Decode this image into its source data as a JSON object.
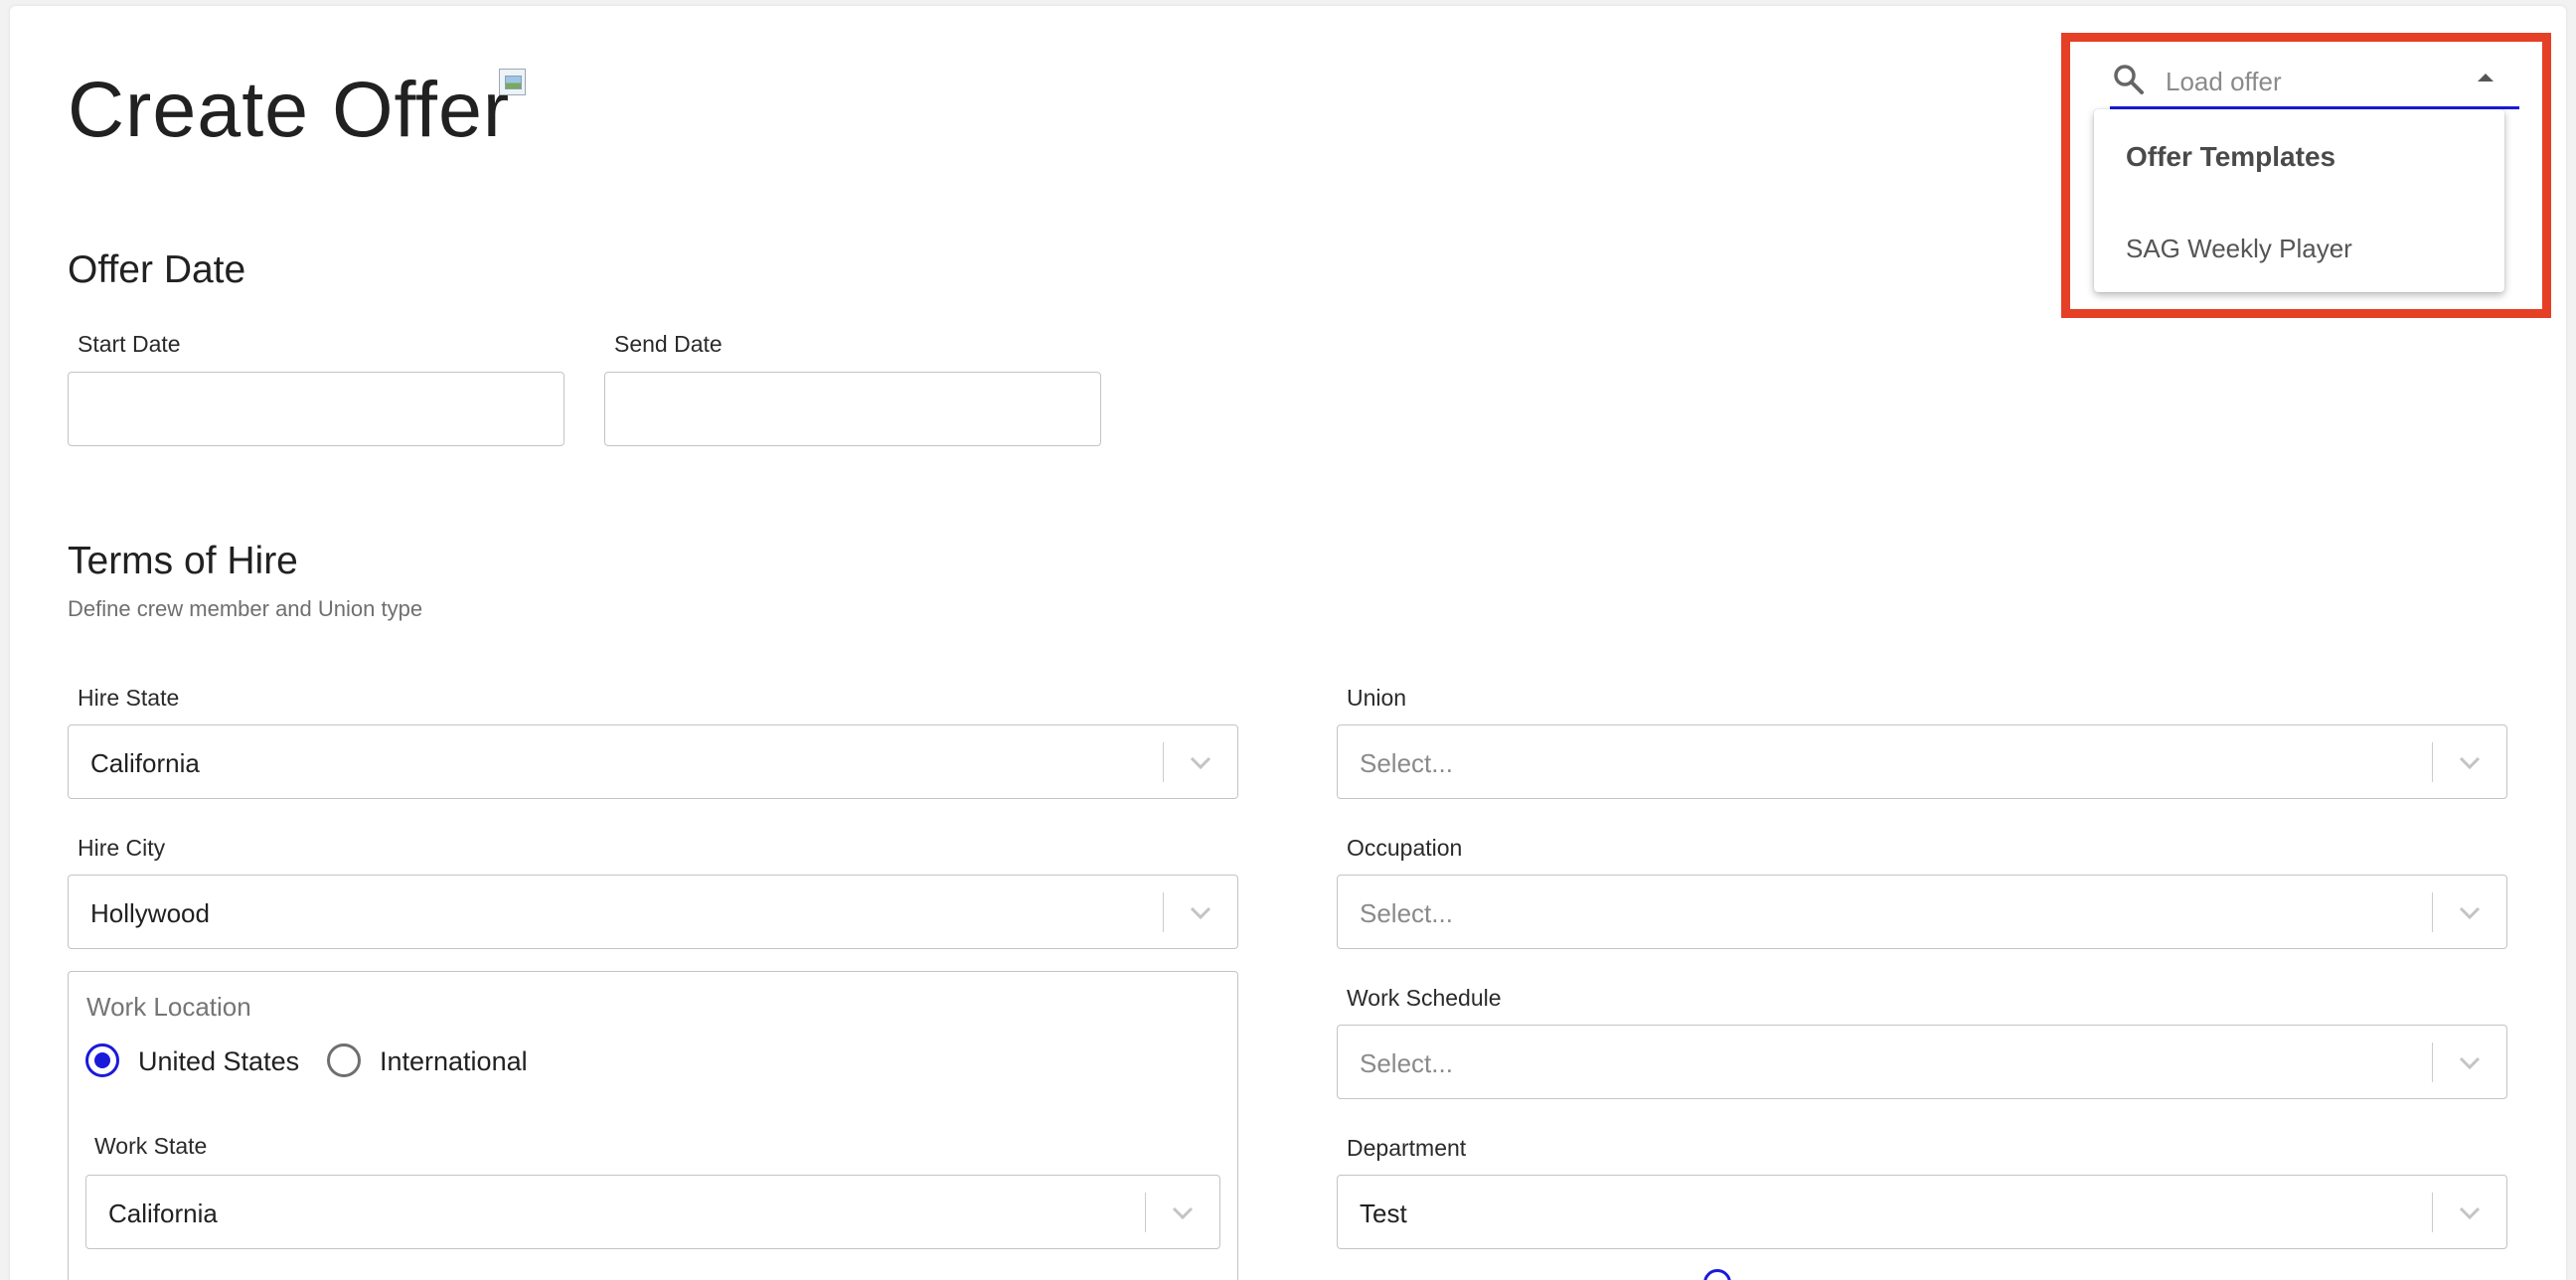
{
  "page": {
    "title": "Create Offer"
  },
  "offer_date": {
    "heading": "Offer Date",
    "start_label": "Start Date",
    "start_value": "",
    "send_label": "Send Date",
    "send_value": ""
  },
  "terms": {
    "heading": "Terms of Hire",
    "subtitle": "Define crew member and Union type",
    "hire_state": {
      "label": "Hire State",
      "value": "California"
    },
    "hire_city": {
      "label": "Hire City",
      "value": "Hollywood"
    },
    "union": {
      "label": "Union",
      "placeholder": "Select..."
    },
    "occupation": {
      "label": "Occupation",
      "placeholder": "Select..."
    },
    "work_schedule": {
      "label": "Work Schedule",
      "placeholder": "Select..."
    },
    "department": {
      "label": "Department",
      "value": "Test"
    },
    "work_location": {
      "legend": "Work Location",
      "options": [
        "United States",
        "International"
      ],
      "selected": "United States",
      "work_state": {
        "label": "Work State",
        "value": "California"
      }
    }
  },
  "load_offer": {
    "placeholder": "Load offer",
    "menu_header": "Offer Templates",
    "items": [
      "SAG Weekly Player"
    ]
  },
  "colors": {
    "accent": "#1a1adb",
    "highlight": "#e53f26"
  },
  "icons": [
    "search-icon",
    "caret-up-icon",
    "chevron-down-icon",
    "broken-image-icon"
  ]
}
